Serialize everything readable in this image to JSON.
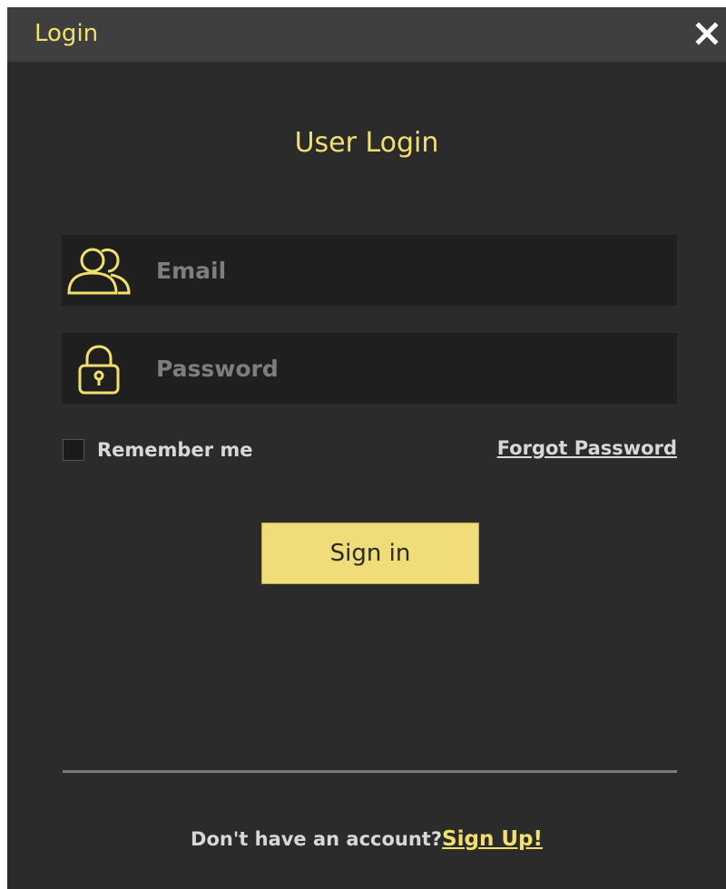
{
  "window": {
    "title": "Login"
  },
  "form": {
    "heading": "User Login",
    "email": {
      "icon": "users-icon",
      "placeholder": "Email",
      "value": ""
    },
    "password": {
      "icon": "lock-icon",
      "placeholder": "Password",
      "value": ""
    },
    "remember_label": "Remember me",
    "remember_checked": false,
    "forgot_label": "Forgot Password",
    "signin_label": "Sign in"
  },
  "footer": {
    "prompt": "Don't have an account?",
    "signup_label": "Sign Up!"
  },
  "colors": {
    "accent": "#f2e06b",
    "button_bg": "#f0dc78",
    "window_bg": "#2b2b2b",
    "titlebar_bg": "#3f3f3f",
    "field_bg": "#1f1f1f"
  }
}
